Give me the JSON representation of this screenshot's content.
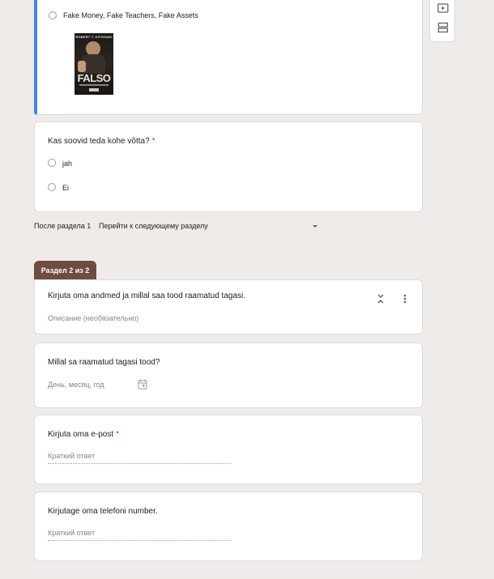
{
  "question1": {
    "option_label": "Fake Money, Fake Teachers, Fake Assets",
    "book": {
      "author": "ROBERT T. KIYOSAKI",
      "title": "FALSO"
    }
  },
  "question2": {
    "title": "Kas soovid teda kohe võtta?",
    "required_mark": "*",
    "options": [
      "jah",
      "Ei"
    ]
  },
  "after_section": {
    "label": "После раздела 1",
    "action": "Перейти к следующему разделу"
  },
  "section2": {
    "tab_label": "Раздел 2 из 2",
    "title": "Kirjuta oma andmed ja millal saa tood raamatud tagasi.",
    "description_placeholder": "Описание (необязательно)"
  },
  "question_date": {
    "title": "Millal sa raamatud tagasi tood?",
    "placeholder": "День, месяц, год"
  },
  "question_email": {
    "title": "Kirjuta oma e-post",
    "required_mark": "*",
    "placeholder": "Краткий ответ"
  },
  "question_phone": {
    "title": "Kirjutage oma telefoni number.",
    "placeholder": "Краткий ответ"
  },
  "colors": {
    "background": "#efebe9",
    "accent": "#4285f4",
    "section_tab": "#6d4c41",
    "required": "#d93025"
  }
}
